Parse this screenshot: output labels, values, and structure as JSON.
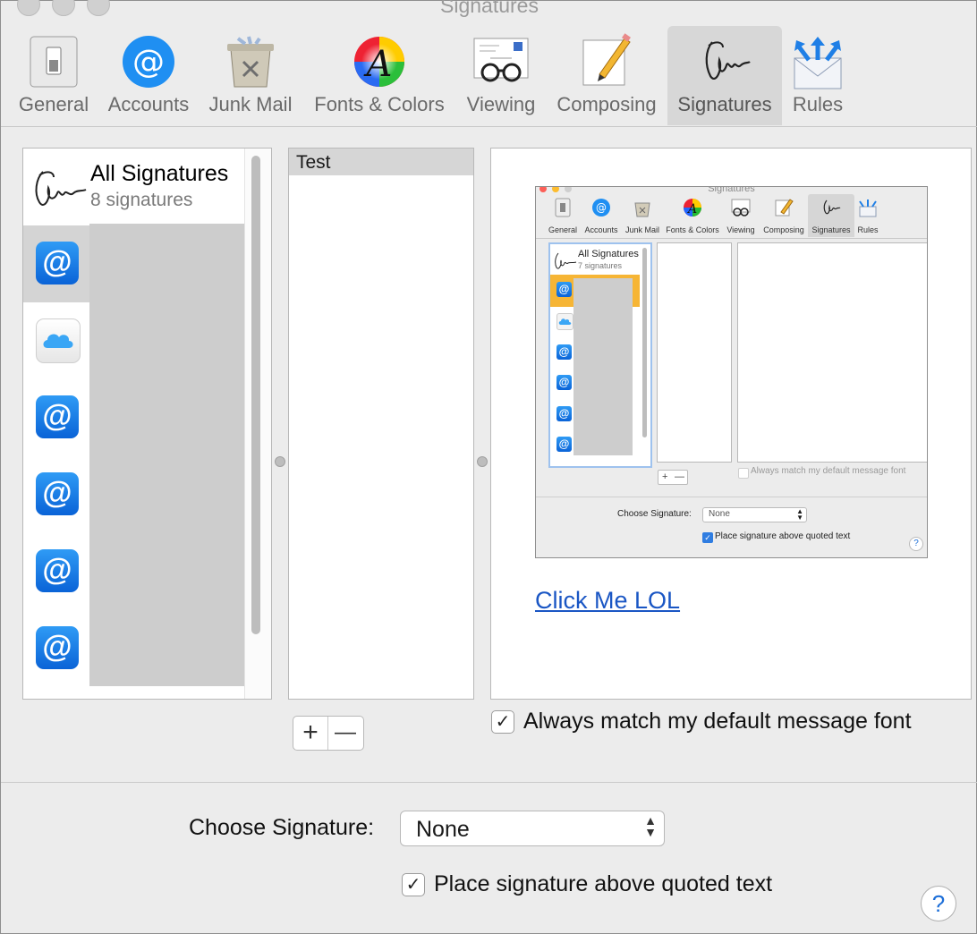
{
  "window": {
    "title": "Signatures"
  },
  "toolbar": {
    "items": [
      {
        "label": "General",
        "icon": "general-switch-icon"
      },
      {
        "label": "Accounts",
        "icon": "accounts-at-icon"
      },
      {
        "label": "Junk Mail",
        "icon": "junk-mail-trash-icon"
      },
      {
        "label": "Fonts & Colors",
        "icon": "fonts-colors-icon"
      },
      {
        "label": "Viewing",
        "icon": "viewing-glasses-icon"
      },
      {
        "label": "Composing",
        "icon": "composing-pencil-icon"
      },
      {
        "label": "Signatures",
        "icon": "signature-icon",
        "selected": true
      },
      {
        "label": "Rules",
        "icon": "rules-envelope-icon"
      }
    ]
  },
  "accounts": {
    "all_signatures_title": "All Signatures",
    "all_signatures_count": "8 signatures",
    "rows": [
      {
        "icon": "at-icon",
        "selected": true
      },
      {
        "icon": "icloud-icon"
      },
      {
        "icon": "at-icon"
      },
      {
        "icon": "at-icon"
      },
      {
        "icon": "at-icon"
      },
      {
        "icon": "at-icon"
      }
    ]
  },
  "signatures": {
    "items": [
      "Test"
    ]
  },
  "buttons": {
    "add": "+",
    "remove": "—"
  },
  "preview": {
    "link_text": "Click Me LOL",
    "embedded_screenshot": {
      "title": "Signatures",
      "toolbar_labels": [
        "General",
        "Accounts",
        "Junk Mail",
        "Fonts & Colors",
        "Viewing",
        "Composing",
        "Signatures",
        "Rules"
      ],
      "all_signatures_title": "All Signatures",
      "all_signatures_count": "7 signatures",
      "always_match": "Always match my default message font",
      "choose_signature_label": "Choose Signature:",
      "choose_signature_value": "None",
      "place_above": "Place signature above quoted text",
      "add": "+",
      "remove": "—",
      "help": "?"
    }
  },
  "options": {
    "always_match_label": "Always match my default message font",
    "always_match_checked": true,
    "choose_signature_label": "Choose Signature:",
    "choose_signature_value": "None",
    "place_above_label": "Place signature above quoted text",
    "place_above_checked": true
  },
  "help": {
    "label": "?"
  },
  "colors": {
    "accent": "#0a63d7",
    "link": "#1a56c4",
    "selection_gray": "#d4d4d4"
  }
}
